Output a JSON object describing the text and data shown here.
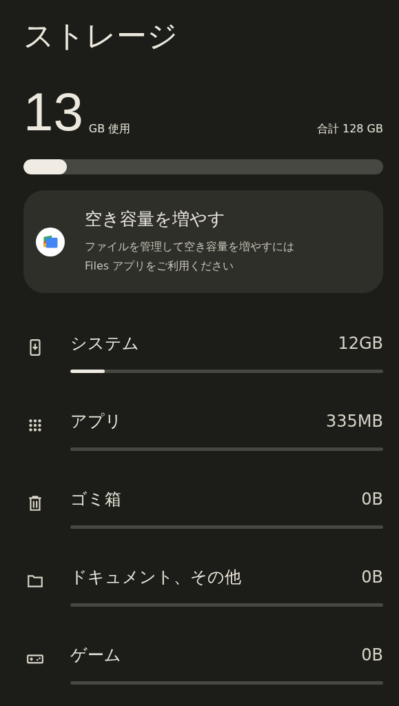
{
  "title": "ストレージ",
  "usage": {
    "amount": "13",
    "unit": "GB 使用",
    "total": "合計 128 GB",
    "level": 0.12
  },
  "card": {
    "title": "空き容量を増やす",
    "text": "ファイルを管理して空き容量を増やすには Files アプリをご利用ください"
  },
  "categories": [
    {
      "kind": "phone",
      "label": "システム",
      "size": "12GB",
      "level": 0.11
    },
    {
      "kind": "apps",
      "label": "アプリ",
      "size": "335MB"
    },
    {
      "kind": "trash",
      "label": "ゴミ箱",
      "size": "0B"
    },
    {
      "kind": "folder",
      "label": "ドキュメント、その他",
      "size": "0B"
    },
    {
      "kind": "game",
      "label": "ゲーム",
      "size": "0B"
    }
  ]
}
